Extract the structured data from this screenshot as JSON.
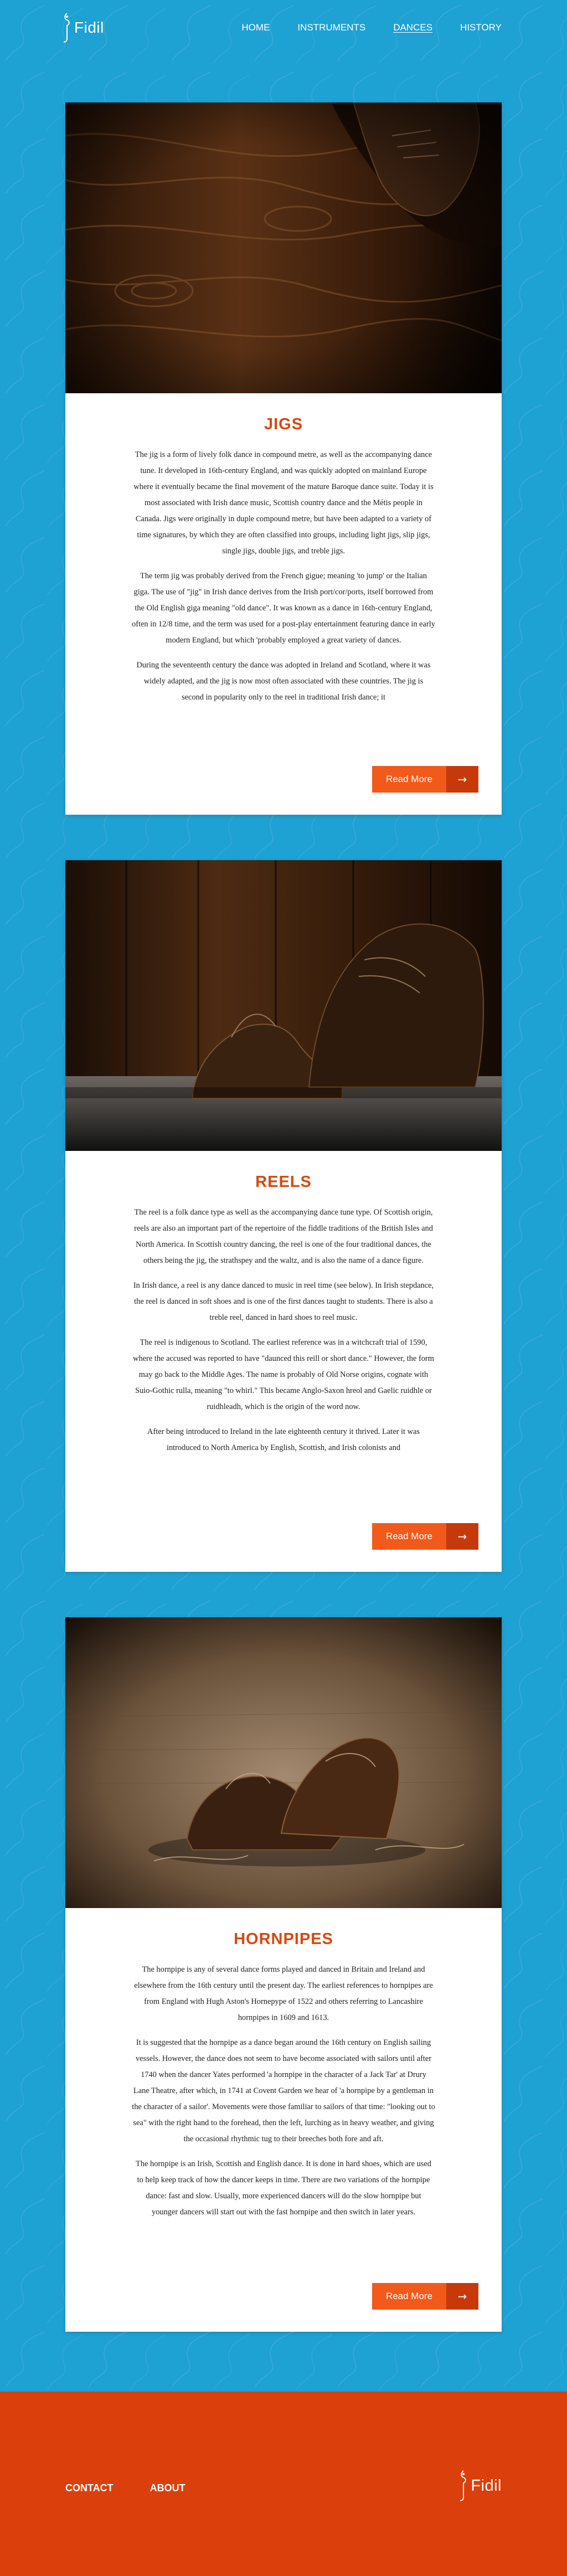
{
  "brand": {
    "name": "Fidil"
  },
  "nav": {
    "items": [
      {
        "label": "HOME"
      },
      {
        "label": "INSTRUMENTS"
      },
      {
        "label": "DANCES"
      },
      {
        "label": "HISTORY"
      }
    ],
    "active": "DANCES"
  },
  "sections": [
    {
      "title": "JIGS",
      "paragraphs": [
        "The jig is a form of lively folk dance in compound metre, as well as the accompanying dance tune. It developed in 16th-century England, and was quickly adopted on mainland Europe where it eventually became the final movement of the mature Baroque dance suite. Today it is most associated with Irish dance music, Scottish country dance and the Métis people in Canada. Jigs were originally in duple compound metre, but have been adapted to a variety of time signatures, by which they are often classified into groups, including light jigs, slip jigs, single jigs, double jigs, and treble jigs.",
        "The term jig was probably derived from the French gigue; meaning 'to jump' or the Italian giga. The use of \"jig\" in Irish dance derives from the Irish port/cor/ports, itself borrowed from the Old English giga meaning \"old dance\". It was known as a dance in 16th-century England, often in 12/8 time, and the term was used for a post-play entertainment featuring dance in early modern England, but which 'probably employed a great variety of dances.",
        "During the seventeenth century the dance was adopted in Ireland and Scotland, where it was widely adapted, and the jig is now most often associated with these countries. The jig is second in popularity only to the reel in traditional Irish dance; it"
      ],
      "button": {
        "label": "Read More",
        "icon": "arrow-right-icon"
      }
    },
    {
      "title": "REELS",
      "paragraphs": [
        "The reel is a folk dance type as well as the accompanying dance tune type. Of Scottish origin, reels are also an important part of the repertoire of the fiddle traditions of the British Isles and North America. In Scottish country dancing, the reel is one of the four traditional dances, the others being the jig, the strathspey and the waltz, and is also the name of a dance figure.",
        "In Irish dance, a reel is any dance danced to music in reel time (see below). In Irish stepdance, the reel is danced in soft shoes and is one of the first dances taught to students. There is also a treble reel, danced in hard shoes to reel music.",
        "The reel is indigenous to Scotland. The earliest reference was in a witchcraft trial of 1590, where the accused was reported to have \"daunced this reill or short dance.\" However, the form may go back to the Middle Ages. The name is probably of Old Norse origins, cognate with Suio-Gothic rulla, meaning \"to whirl.\" This became Anglo-Saxon hreol and Gaelic ruidhle or ruidhleadh, which is the origin of the word now.",
        "After being introduced to Ireland in the late eighteenth century it thrived. Later it was introduced to North America by English, Scottish, and Irish colonists and"
      ],
      "button": {
        "label": "Read More",
        "icon": "arrow-right-icon"
      }
    },
    {
      "title": "HORNPIPES",
      "paragraphs": [
        "The hornpipe is any of several dance forms played and danced in Britain and Ireland and elsewhere from the 16th century until the present day. The earliest references to hornpipes are from England with Hugh Aston's Hornepype of 1522 and others referring to Lancashire hornpipes in 1609 and 1613.",
        "It is suggested that the hornpipe as a dance began around the 16th century on English sailing vessels. However, the dance does not seem to have become associated with sailors until after 1740 when the dancer Yates performed 'a hornpipe in the character of a Jack Tar' at Drury Lane Theatre, after which, in 1741 at Covent Garden we hear of 'a hornpipe by a gentleman in the character of a sailor'. Movements were those familiar to sailors of that time: \"looking out to sea\" with the right hand to the forehead, then the left, lurching as in heavy weather, and giving the occasional rhythmic tug to their breeches both fore and aft.",
        "The hornpipe is an Irish, Scottish and English dance. It is done in hard shoes, which are used to help keep track of how the dancer keeps in time. There are two variations of the hornpipe dance: fast and slow. Usually, more experienced dancers will do the slow hornpipe but younger dancers will start out with the fast hornpipe and then switch in later years."
      ],
      "button": {
        "label": "Read More",
        "icon": "arrow-right-icon"
      }
    }
  ],
  "footer": {
    "links": [
      {
        "label": "CONTACT"
      },
      {
        "label": "ABOUT"
      }
    ],
    "brand": "Fidil"
  },
  "colors": {
    "background": "#1ea1d3",
    "accent": "#d9480f",
    "button": "#f15a1a",
    "button_dark": "#c6390a",
    "footer": "#db3f0c"
  }
}
